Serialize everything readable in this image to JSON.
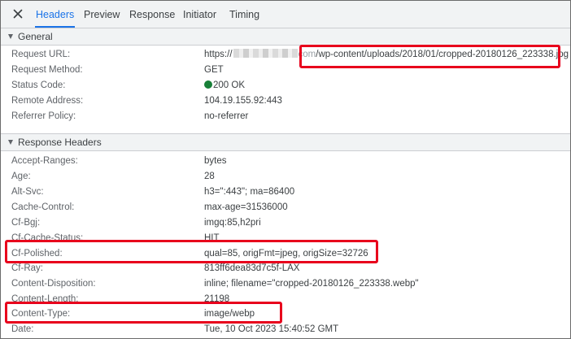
{
  "tabs": [
    {
      "label": "Headers",
      "active": true
    },
    {
      "label": "Preview",
      "active": false
    },
    {
      "label": "Response",
      "active": false
    },
    {
      "label": "Initiator",
      "active": false
    },
    {
      "label": "Timing",
      "active": false
    }
  ],
  "general": {
    "title": "General",
    "request_url": {
      "key": "Request URL:",
      "prefix": "https://",
      "hidden_suffix": "com",
      "path": "/wp-content/uploads/2018/01/cropped-20180126_223338.jpg"
    },
    "rows": [
      {
        "key": "Request Method:",
        "value": "GET"
      },
      {
        "key": "Status Code:",
        "value": "200 OK"
      },
      {
        "key": "Remote Address:",
        "value": "104.19.155.92:443"
      },
      {
        "key": "Referrer Policy:",
        "value": "no-referrer"
      }
    ]
  },
  "response_headers": {
    "title": "Response Headers",
    "rows": [
      {
        "key": "Accept-Ranges:",
        "value": "bytes"
      },
      {
        "key": "Age:",
        "value": "28"
      },
      {
        "key": "Alt-Svc:",
        "value": "h3=\":443\"; ma=86400"
      },
      {
        "key": "Cache-Control:",
        "value": "max-age=31536000"
      },
      {
        "key": "Cf-Bgj:",
        "value": "imgq:85,h2pri"
      },
      {
        "key": "Cf-Cache-Status:",
        "value": "HIT"
      },
      {
        "key": "Cf-Polished:",
        "value": "qual=85, origFmt=jpeg, origSize=32726"
      },
      {
        "key": "Cf-Ray:",
        "value": "813ff6dea83d7c5f-LAX"
      },
      {
        "key": "Content-Disposition:",
        "value": "inline; filename=\"cropped-20180126_223338.webp\""
      },
      {
        "key": "Content-Length:",
        "value": "21198"
      },
      {
        "key": "Content-Type:",
        "value": "image/webp"
      },
      {
        "key": "Date:",
        "value": "Tue, 10 Oct 2023 15:40:52 GMT"
      }
    ]
  },
  "colors": {
    "accent": "#1a73e8",
    "highlight": "#e8001c",
    "status_ok": "#188038"
  }
}
